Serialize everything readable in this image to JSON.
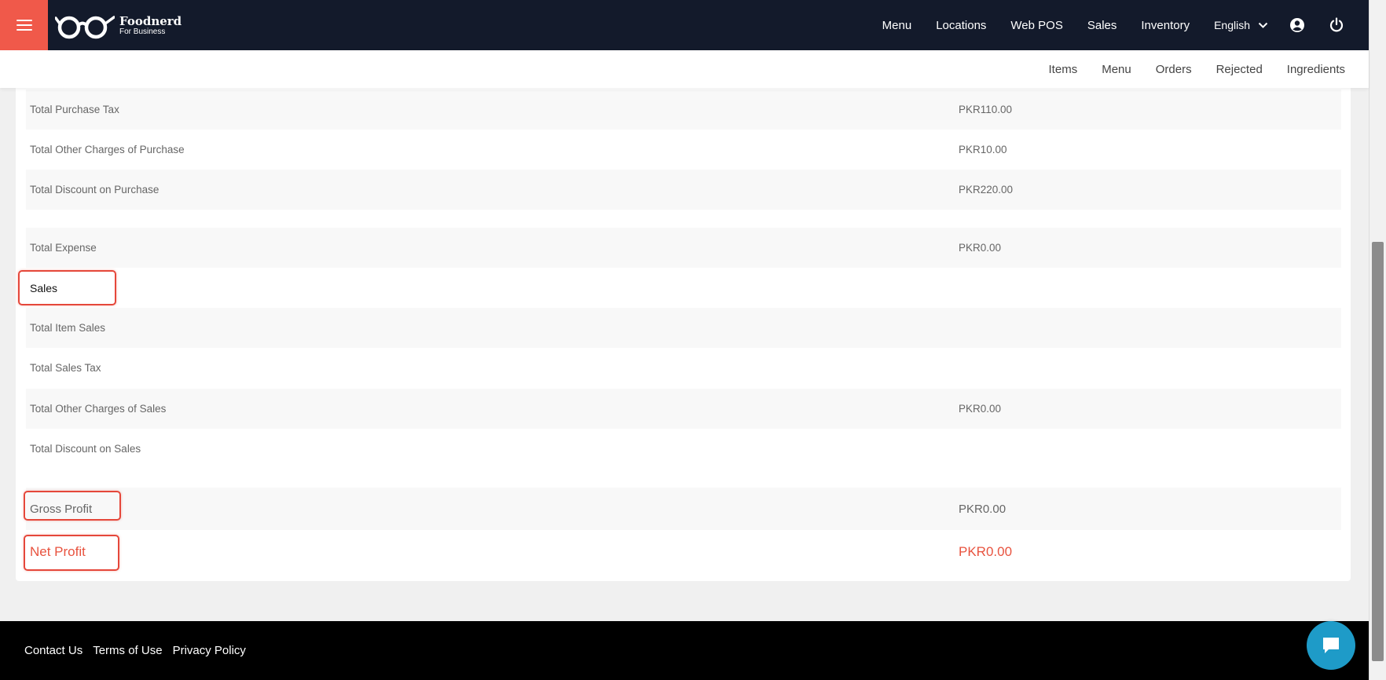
{
  "topnav": {
    "brand_name": "Foodnerd",
    "brand_sub": "For Business",
    "links": [
      "Menu",
      "Locations",
      "Web POS",
      "Sales",
      "Inventory"
    ],
    "language": "English",
    "accent_color": "#f0594a",
    "bg_color": "#131a2b"
  },
  "subnav": {
    "links": [
      "Items",
      "Menu",
      "Orders",
      "Rejected",
      "Ingredients"
    ]
  },
  "report": {
    "rows": [
      {
        "label": "Total Purchase Tax",
        "value": "PKR110.00"
      },
      {
        "label": "Total Other Charges of Purchase",
        "value": "PKR10.00"
      },
      {
        "label": "Total Discount on Purchase",
        "value": "PKR220.00"
      },
      {
        "label": "Total Expense",
        "value": "PKR0.00"
      },
      {
        "label": "Sales",
        "value": ""
      },
      {
        "label": "Total Item Sales",
        "value": ""
      },
      {
        "label": "Total Sales Tax",
        "value": ""
      },
      {
        "label": "Total Other Charges of Sales",
        "value": "PKR0.00"
      },
      {
        "label": "Total Discount on Sales",
        "value": ""
      },
      {
        "label": "Gross Profit",
        "value": "PKR0.00"
      },
      {
        "label": "Net Profit",
        "value": "PKR0.00"
      }
    ],
    "highlight_color": "#e5473a",
    "net_profit_color": "#e8533f"
  },
  "footer": {
    "links": [
      "Contact Us",
      "Terms of Use",
      "Privacy Policy"
    ]
  },
  "icons": {
    "menu": "hamburger-icon",
    "language_toggle": "chevron-down-icon",
    "account": "user-circle-icon",
    "logout": "power-icon",
    "chat": "chat-bubble-icon"
  }
}
